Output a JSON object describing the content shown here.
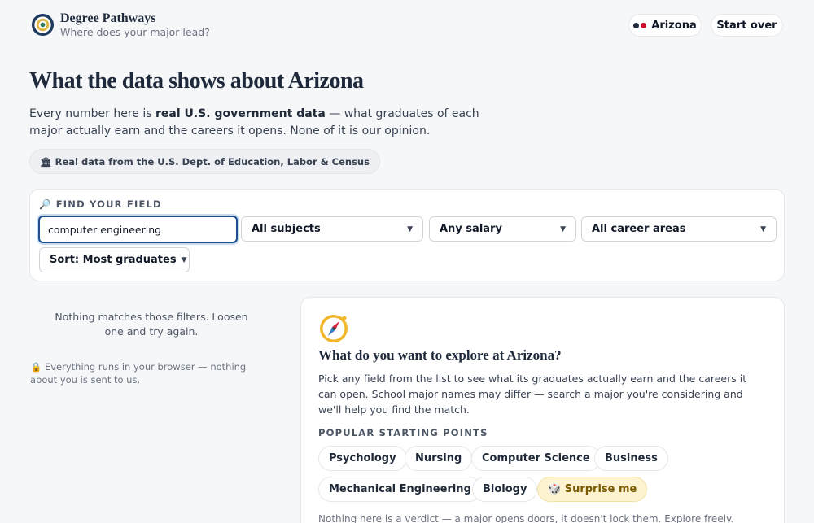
{
  "header": {
    "brand_title": "Degree Pathways",
    "brand_subtitle": "Where does your major lead?",
    "state_label": "Arizona",
    "state_colors": [
      "#1e293b",
      "#c8102e"
    ],
    "start_over_label": "Start over",
    "logo_icon": "target-logo-icon"
  },
  "hero": {
    "title": "What the data shows about Arizona",
    "intro_prefix": "Every number here is ",
    "intro_bold": "real U.S. government data",
    "intro_suffix": " — what graduates of each major actually earn and the careers it opens. None of it is our opinion.",
    "source_badge": "🏛 Real data from the U.S. Dept. of Education, Labor & Census"
  },
  "filters": {
    "section_label": "🔎 FIND YOUR FIELD",
    "search_value": "computer engineering",
    "subjects": "All subjects",
    "salary": "Any salary",
    "career_areas": "All career areas",
    "sort": "Sort: Most graduates"
  },
  "results": {
    "empty_message": "Nothing matches those filters. Loosen one and try again.",
    "privacy_note": "🔒 Everything runs in your browser — nothing about you is sent to us."
  },
  "explore": {
    "icon": "compass-icon",
    "title": "What do you want to explore at Arizona?",
    "text": "Pick any field from the list to see what its graduates actually earn and the careers it can open. School major names may differ — search a major you're considering and we'll help you find the match.",
    "popular_label": "POPULAR STARTING POINTS",
    "chips": [
      "Psychology",
      "Nursing",
      "Computer Science",
      "Business",
      "Mechanical Engineering",
      "Biology"
    ],
    "surprise_label": "🎲 Surprise me",
    "footnote": "Nothing here is a verdict — a major opens doors, it doesn't lock them. Explore freely."
  }
}
